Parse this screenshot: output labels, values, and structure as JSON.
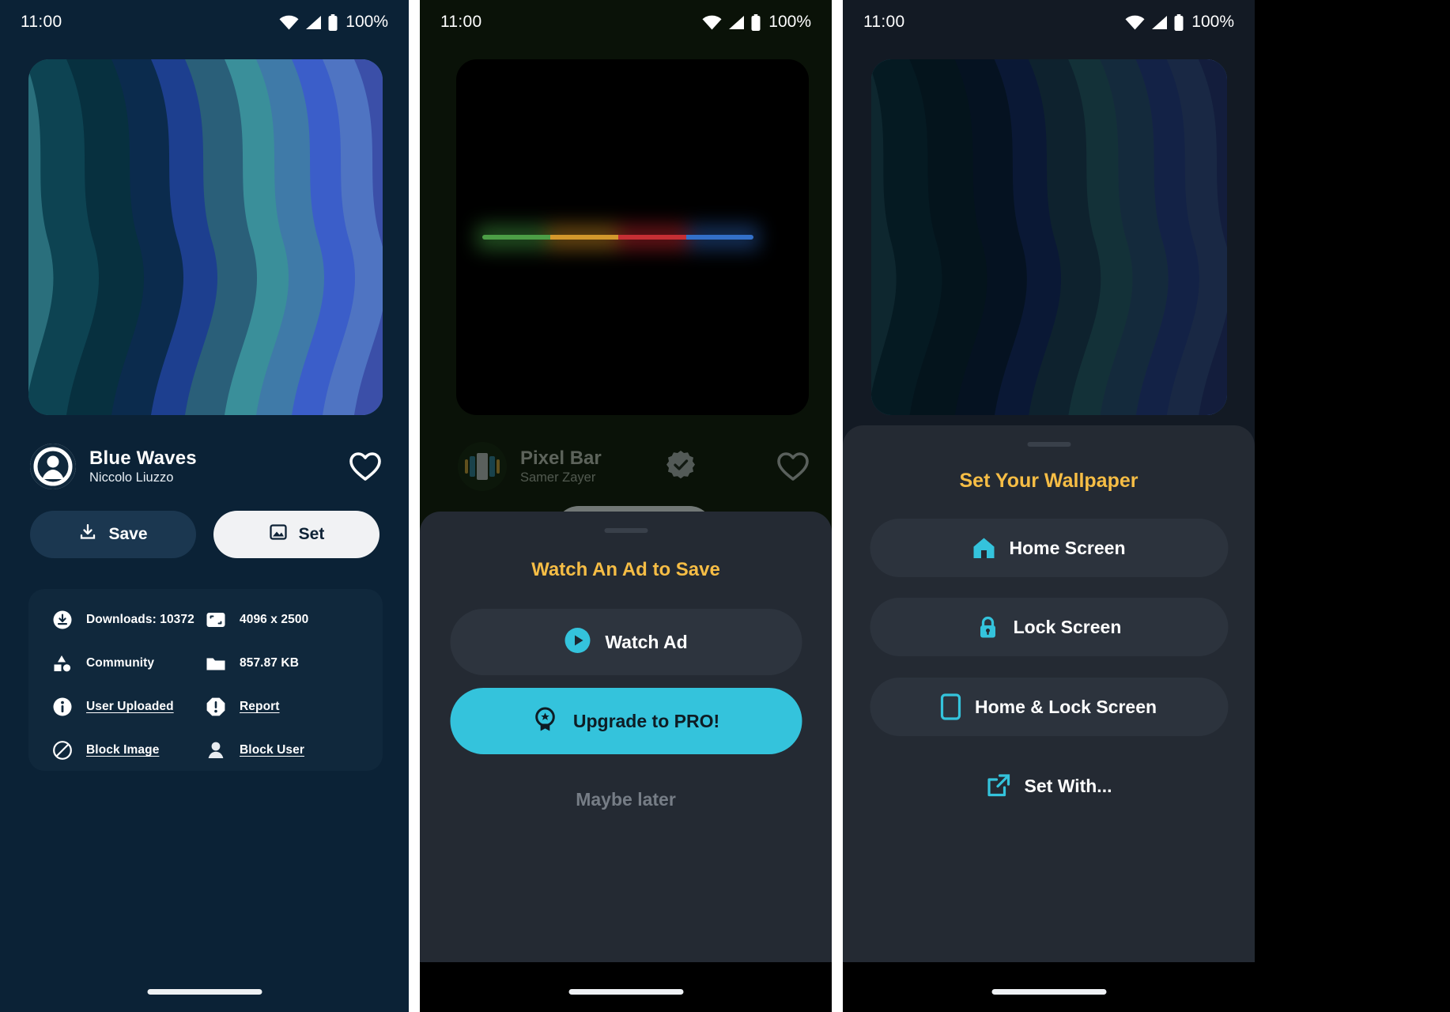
{
  "status_bar": {
    "time": "11:00",
    "battery": "100%",
    "icons": [
      "wifi-icon",
      "cellular-signal-icon",
      "battery-icon"
    ]
  },
  "panel_detail": {
    "wallpaper_name": "Blue Waves",
    "wallpaper_author": "Niccolo Liuzzo",
    "favorite_icon": "heart-outline-icon",
    "avatar_icon": "account-circle-icon",
    "buttons": {
      "save_label": "Save",
      "save_icon": "download-icon",
      "set_label": "Set",
      "set_icon": "image-icon"
    },
    "info": [
      {
        "icon": "download-circle-icon",
        "label": "Downloads: 10372",
        "link": false
      },
      {
        "icon": "resolution-icon",
        "label": "4096 x 2500",
        "link": false
      },
      {
        "icon": "community-shapes-icon",
        "label": "Community",
        "link": false
      },
      {
        "icon": "folder-icon",
        "label": "857.87 KB",
        "link": false
      },
      {
        "icon": "info-circle-icon",
        "label": "User Uploaded",
        "link": true
      },
      {
        "icon": "report-alert-icon",
        "label": "Report",
        "link": true
      },
      {
        "icon": "block-circle-icon",
        "label": "Block Image",
        "link": true
      },
      {
        "icon": "person-icon",
        "label": "Block User",
        "link": true
      }
    ]
  },
  "panel_ad": {
    "wallpaper_name": "Pixel Bar",
    "wallpaper_author": "Samer Zayer",
    "verified_icon": "verified-badge-icon",
    "favorite_icon": "heart-outline-icon",
    "sheet_title": "Watch An Ad to Save",
    "watch_ad_label": "Watch Ad",
    "watch_ad_icon": "play-circle-icon",
    "upgrade_label": "Upgrade to PRO!",
    "upgrade_icon": "award-badge-icon",
    "dismiss_label": "Maybe later",
    "accent_color": "#34c3dc",
    "title_color": "#f6bd45"
  },
  "panel_set": {
    "sheet_title": "Set Your Wallpaper",
    "title_color": "#f6bd45",
    "options": [
      {
        "label": "Home Screen",
        "icon": "home-icon"
      },
      {
        "label": "Lock Screen",
        "icon": "lock-icon"
      },
      {
        "label": "Home & Lock Screen",
        "icon": "smartphone-icon"
      },
      {
        "label": "Set With...",
        "icon": "open-external-icon"
      }
    ],
    "icon_color": "#34c3dc"
  },
  "wallpaper_palette": [
    "#2a6f7c",
    "#0a3040",
    "#0b2b4d",
    "#1d3f8f",
    "#2a5f79",
    "#3a8f9a",
    "#3f7aa8",
    "#3b5ec9",
    "#4f74c2",
    "#3b4fa8",
    "#4a4f92"
  ]
}
